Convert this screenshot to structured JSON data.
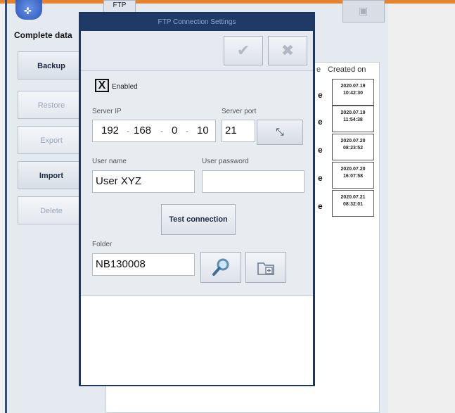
{
  "top_ftp_label": "FTP",
  "left_label": "Complete data",
  "side_buttons": [
    {
      "label": "Backup",
      "active": true
    },
    {
      "label": "Restore",
      "active": false
    },
    {
      "label": "Export",
      "active": false
    },
    {
      "label": "Import",
      "active": true
    },
    {
      "label": "Delete",
      "active": false
    }
  ],
  "table": {
    "col_partial": "e",
    "col_created": "Created on",
    "rows": [
      {
        "mark": "e",
        "date": "2020.07.19",
        "time": "10:42:30"
      },
      {
        "mark": "e",
        "date": "2020.07.19",
        "time": "11:54:38"
      },
      {
        "mark": "e",
        "date": "2020.07.20",
        "time": "08:23:52"
      },
      {
        "mark": "e",
        "date": "2020.07.20",
        "time": "16:07:58"
      },
      {
        "mark": "e",
        "date": "2020.07.21",
        "time": "08:32:01"
      }
    ]
  },
  "dialog": {
    "title": "FTP Connection Settings",
    "ok_icon": "checkmark-icon",
    "cancel_icon": "close-x-icon",
    "enabled_mark": "X",
    "enabled_label": "Enabled",
    "server_ip_label": "Server IP",
    "ip": [
      "192",
      "168",
      "0",
      "10"
    ],
    "ip_sep": "-",
    "server_port_label": "Server port",
    "server_port": "21",
    "port_button_icon": "arrows-diagonal-icon",
    "user_name_label": "User name",
    "user_name": "User XYZ",
    "user_password_label": "User password",
    "user_password": "",
    "test_connection": "Test connection",
    "folder_label": "Folder",
    "folder": "NB130008",
    "search_icon": "magnifier-icon",
    "new_folder_icon": "folder-add-icon"
  }
}
